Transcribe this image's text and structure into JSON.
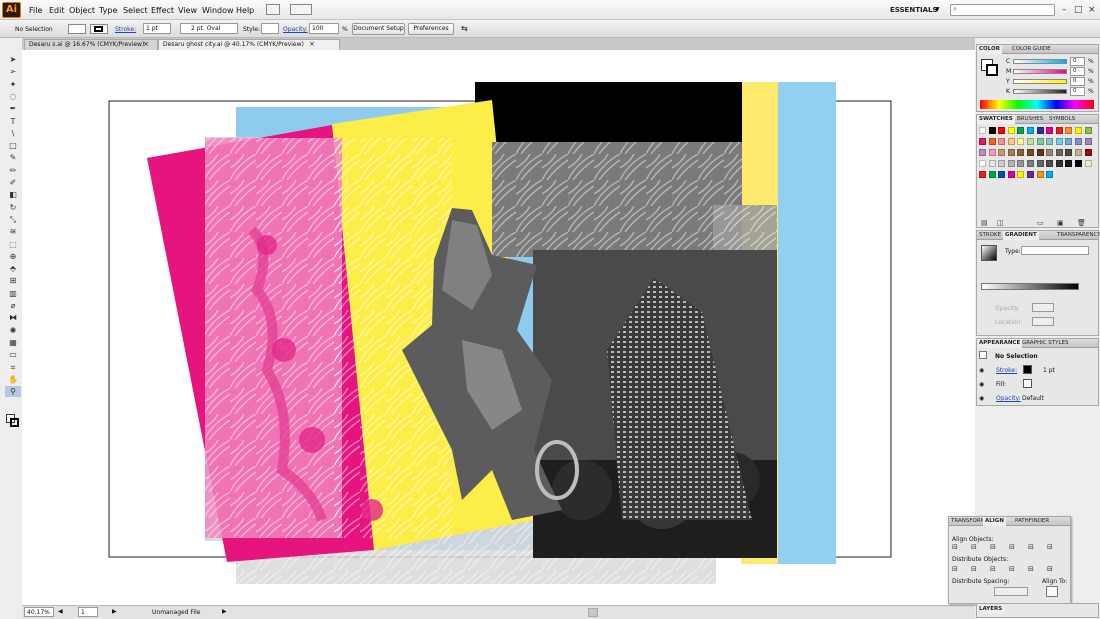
{
  "app": {
    "logo": "Ai"
  },
  "menubar": {
    "items": [
      "File",
      "Edit",
      "Object",
      "Type",
      "Select",
      "Effect",
      "View",
      "Window",
      "Help"
    ],
    "workspace": "ESSENTIALS",
    "window_controls": [
      "–",
      "□",
      "×"
    ]
  },
  "control_bar": {
    "selection": "No Selection",
    "stroke_label": "Stroke:",
    "stroke_weight": "1 pt",
    "brush": "2 pt. Oval",
    "style_label": "Style:",
    "opacity_label": "Opacity:",
    "opacity_value": "100",
    "percent": "%",
    "document_setup": "Document Setup",
    "preferences": "Preferences"
  },
  "doc_tabs": [
    {
      "label": "Desaru s.ai @ 16.67% (CMYK/Preview)",
      "close": "×"
    },
    {
      "label": "Desaru ghost city.ai @ 40.17% (CMYK/Preview)",
      "close": "×"
    }
  ],
  "tools": [
    "select-tool",
    "direct-select-tool",
    "magic-wand-tool",
    "lasso-tool",
    "pen-tool",
    "type-tool",
    "line-tool",
    "rectangle-tool",
    "paintbrush-tool",
    "pencil-tool",
    "blob-brush-tool",
    "eraser-tool",
    "rotate-tool",
    "scale-tool",
    "warp-tool",
    "free-transform-tool",
    "shape-builder-tool",
    "perspective-tool",
    "mesh-tool",
    "gradient-tool",
    "eyedropper-tool",
    "blend-tool",
    "symbol-sprayer-tool",
    "graph-tool",
    "artboard-tool",
    "slice-tool",
    "hand-tool",
    "zoom-tool"
  ],
  "status": {
    "zoom": "40.17%",
    "page": "1",
    "nav_prev": "◀",
    "nav_next": "▶",
    "file_status": "Unmanaged File"
  },
  "color_panel": {
    "tabs": [
      "COLOR",
      "COLOR GUIDE"
    ],
    "channels": [
      {
        "name": "C",
        "value": "0",
        "color": "#00aeef"
      },
      {
        "name": "M",
        "value": "0",
        "color": "#ec008c"
      },
      {
        "name": "Y",
        "value": "0",
        "color": "#fff200"
      },
      {
        "name": "K",
        "value": "0",
        "color": "#231f20"
      }
    ],
    "percent": "%"
  },
  "swatches_panel": {
    "tabs": [
      "SWATCHES",
      "BRUSHES",
      "SYMBOLS"
    ],
    "swatch_colors": [
      "#ffffff",
      "#000000",
      "#ff0000",
      "#ffff00",
      "#00a651",
      "#00aeef",
      "#2e3192",
      "#ec008c",
      "#ed1c24",
      "#f7941d",
      "#fff200",
      "#8dc63f",
      "#ed145b",
      "#f26522",
      "#f7977a",
      "#fdc68a",
      "#fff79a",
      "#c4df9b",
      "#82ca9c",
      "#7accc8",
      "#6dcff6",
      "#7da7d9",
      "#8393ca",
      "#a187be",
      "#bc8dbf",
      "#f49ac2",
      "#c69c6d",
      "#a67c52",
      "#8c6239",
      "#754c24",
      "#603913",
      "#998675",
      "#736357",
      "#534741",
      "#c7b299",
      "#9e0b0f",
      "#ffffff",
      "#e6e6e6",
      "#cccccc",
      "#b3b3b3",
      "#999999",
      "#808080",
      "#666666",
      "#4d4d4d",
      "#333333",
      "#1a1a1a",
      "#000000",
      "#f5e6ce",
      "#ed1c24",
      "#00a651",
      "#0054a6",
      "#ec008c",
      "#fff200",
      "#662d91",
      "#f7941d",
      "#00aeef"
    ]
  },
  "stroke_gradient_panel": {
    "tabs": [
      "STROKE",
      "GRADIENT",
      "TRANSPARENCY"
    ],
    "type_label": "Type:",
    "opacity_label": "Opacity:",
    "location_label": "Location:"
  },
  "appearance_panel": {
    "tabs": [
      "APPEARANCE",
      "GRAPHIC STYLES"
    ],
    "title": "No Selection",
    "stroke_label": "Stroke:",
    "stroke_value": "1 pt",
    "fill_label": "Fill:",
    "opacity_label": "Opacity:",
    "opacity_value": "Default"
  },
  "align_panel": {
    "tabs": [
      "TRANSFORM",
      "ALIGN",
      "PATHFINDER"
    ],
    "align_objects": "Align Objects:",
    "distribute_objects": "Distribute Objects:",
    "distribute_spacing": "Distribute Spacing:",
    "align_to": "Align To:"
  },
  "layers_panel": {
    "tab": "LAYERS"
  }
}
